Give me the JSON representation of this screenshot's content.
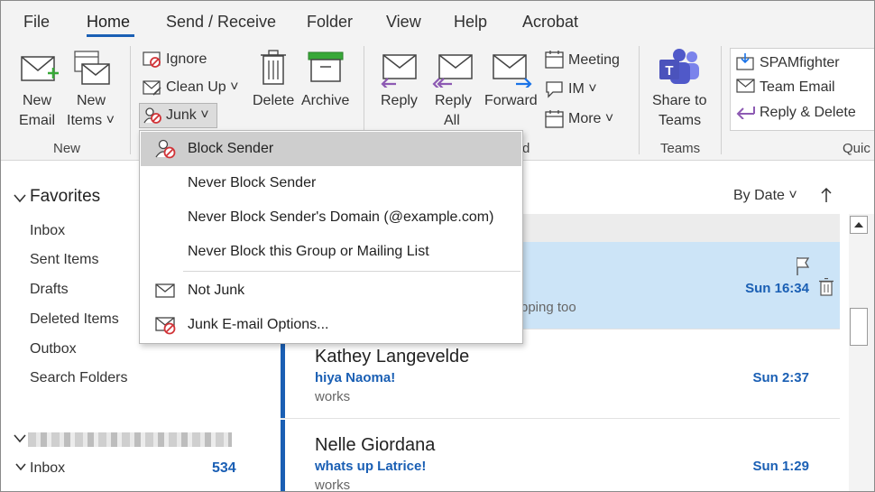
{
  "menu_tabs": [
    "File",
    "Home",
    "Send / Receive",
    "Folder",
    "View",
    "Help",
    "Acrobat"
  ],
  "active_tab": "Home",
  "ribbon": {
    "new_email": [
      "New",
      "Email"
    ],
    "new_items": [
      "New",
      "Items ˅"
    ],
    "group_new": "New",
    "ignore": "Ignore",
    "clean_up": "Clean Up ˅",
    "junk": "Junk ˅",
    "delete": "Delete",
    "archive": "Archive",
    "reply": "Reply",
    "reply_all": [
      "Reply",
      "All"
    ],
    "forward": "Forward",
    "meeting": "Meeting",
    "im": "IM ˅",
    "more": "More ˅",
    "group_respond_partial": "d",
    "share_to_teams": [
      "Share to",
      "Teams"
    ],
    "group_teams": "Teams",
    "quick_steps": [
      "SPAMfighter",
      "Team Email",
      "Reply & Delete"
    ],
    "group_quick_partial": "Quic"
  },
  "junk_menu": {
    "items": [
      {
        "label": "Block Sender",
        "mnemonic": "B",
        "icon": "block-sender-icon",
        "highlighted": true
      },
      {
        "label": "Never Block Sender",
        "mnemonic": "S"
      },
      {
        "label": "Never Block Sender's Domain (@example.com)",
        "mnemonic": "D"
      },
      {
        "label": "Never Block this Group or Mailing List",
        "mnemonic": "M"
      },
      {
        "label": "Not Junk",
        "mnemonic": "N",
        "icon": "envelope-icon"
      },
      {
        "label": "Junk E-mail Options...",
        "mnemonic": "O",
        "icon": "junk-options-icon"
      }
    ]
  },
  "folders": {
    "favorites_title": "Favorites",
    "items": [
      "Inbox",
      "Sent Items",
      "Drafts",
      "Deleted Items",
      "Outbox",
      "Search Folders"
    ],
    "account_inbox": "Inbox",
    "account_inbox_count": "534"
  },
  "list": {
    "sort_label": "By Date ˅",
    "messages": [
      {
        "from": "",
        "subject": "",
        "preview": "pping too",
        "time": "Sun 16:34",
        "selected": true
      },
      {
        "from": "Kathey Langevelde",
        "subject": "hiya Naoma!",
        "preview": "works",
        "time": "Sun 2:37"
      },
      {
        "from": "Nelle Giordana",
        "subject": "whats up Latrice!",
        "preview": "works",
        "time": "Sun 1:29"
      }
    ]
  },
  "colors": {
    "accent": "#1a5fb4",
    "selected_row": "#cce4f7",
    "ribbon_bg": "#f3f3f3",
    "menu_highlight": "#cecece",
    "icon_red": "#d13438",
    "icon_purple": "#8d5ab3",
    "icon_green": "#38a838"
  }
}
